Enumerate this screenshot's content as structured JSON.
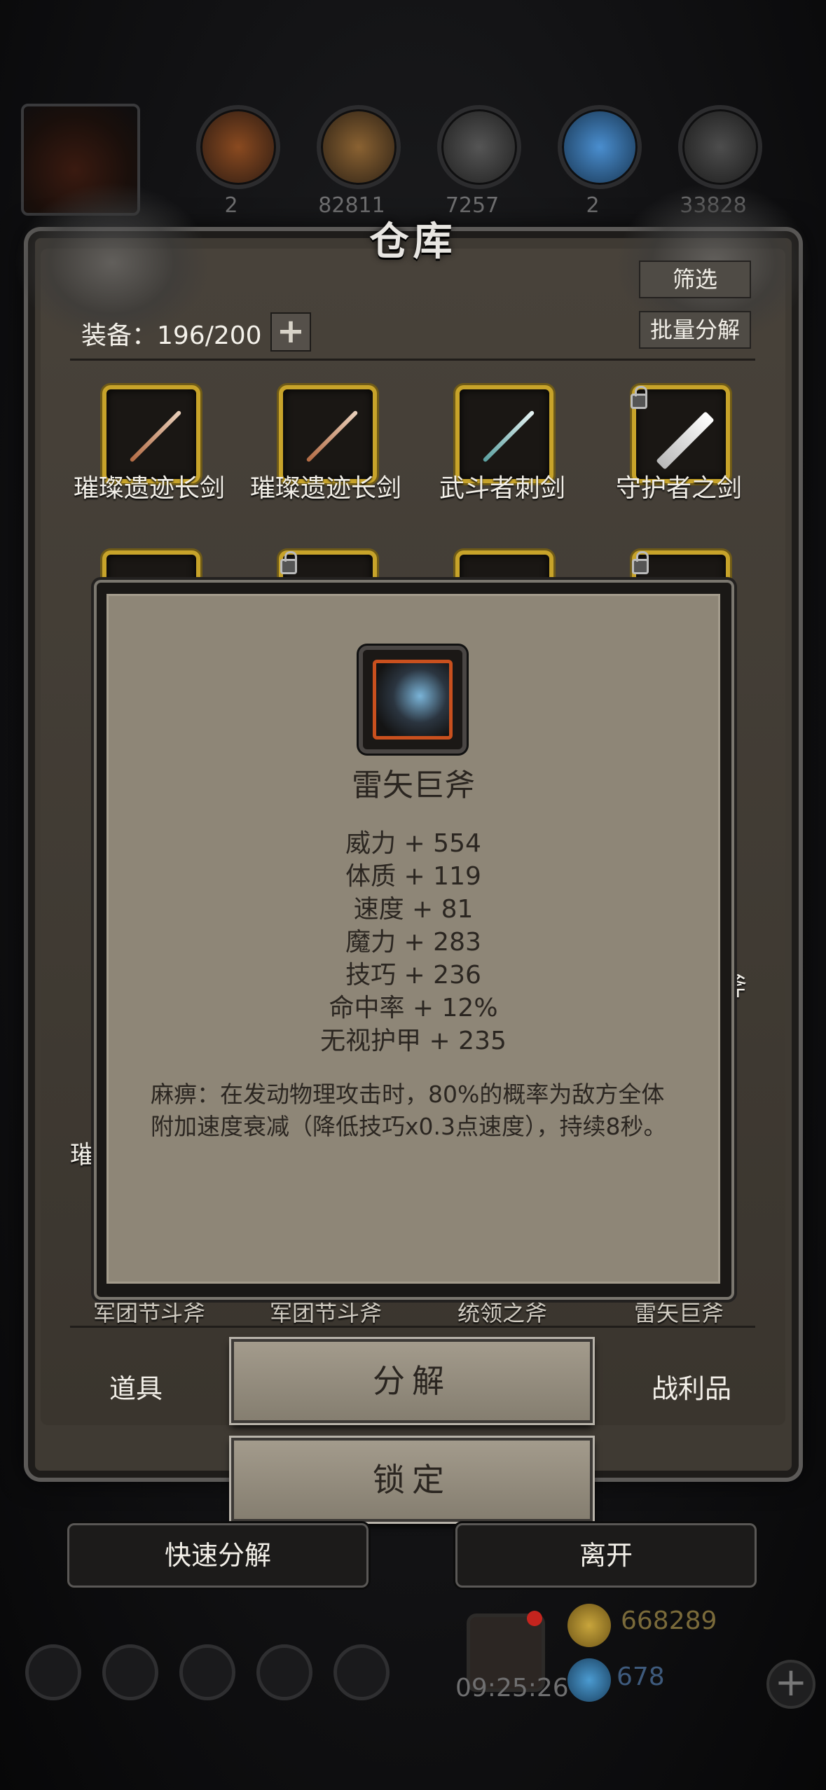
{
  "resources": {
    "counts": [
      "2",
      "82811",
      "7257",
      "2",
      "33828"
    ]
  },
  "warehouse": {
    "title": "仓库",
    "filter_label": "筛选",
    "batch_decompose_label": "批量分解",
    "equip_label": "装备：196/200",
    "add_label": "+",
    "items_row1": [
      {
        "name": "璀璨遗迹长剑",
        "locked": false
      },
      {
        "name": "璀璨遗迹长剑",
        "locked": false
      },
      {
        "name": "武斗者刺剑",
        "locked": false
      },
      {
        "name": "守护者之剑",
        "locked": true
      }
    ],
    "items_row2_locked": [
      false,
      true,
      false,
      true
    ],
    "peek_labels": [
      "斧",
      "璀"
    ],
    "bottom_row_names": [
      "军团节斗斧",
      "军团节斗斧",
      "统领之斧",
      "雷矢巨斧"
    ]
  },
  "tooltip": {
    "name": "雷矢巨斧",
    "stats": [
      "威力 + 554",
      "体质 + 119",
      "速度 + 81",
      "魔力 + 283",
      "技巧 + 236",
      "命中率 + 12%",
      "无视护甲 + 235"
    ],
    "description": "麻痹：在发动物理攻击时，80%的概率为敌方全体附加速度衰减（降低技巧x0.3点速度），持续8秒。"
  },
  "tabs": {
    "items": "道具",
    "loot": "战利品"
  },
  "actions": {
    "decompose": "分解",
    "lock": "锁定",
    "quick_decompose": "快速分解",
    "leave": "离开"
  },
  "hud": {
    "clock": "09:25:26",
    "gold": "668289",
    "gems": "678"
  },
  "colors": {
    "item_border": "#c7a32a",
    "tooltip_bg": "#8e8677",
    "rare_border": "#c9501e"
  }
}
